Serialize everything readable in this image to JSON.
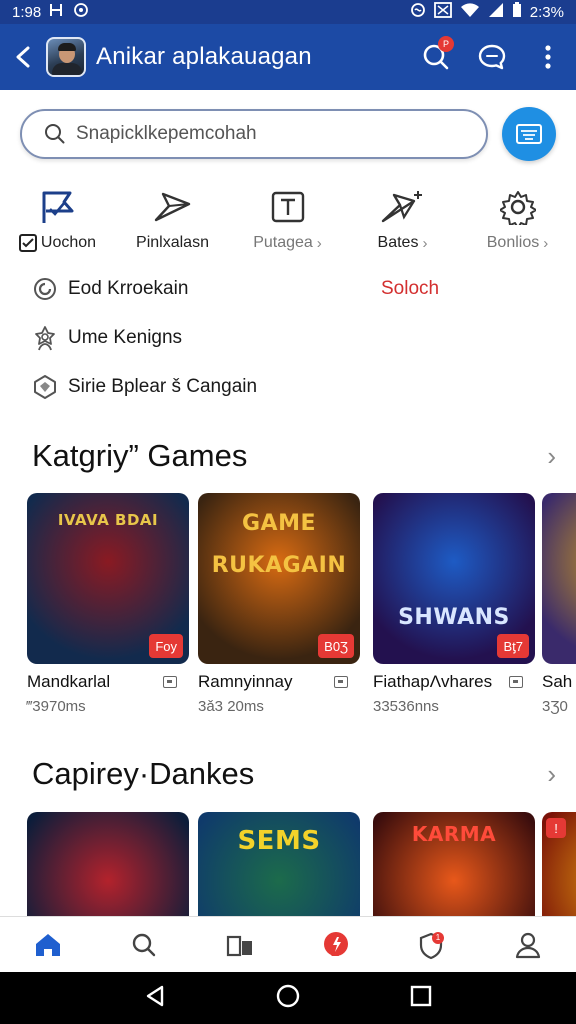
{
  "status_bar": {
    "time": "1:98",
    "left_icons": [
      "sim-icon",
      "sync-icon"
    ],
    "right_icons": [
      "nfc-icon",
      "notification-icon",
      "wifi-icon",
      "signal-icon",
      "battery-icon"
    ],
    "battery": "2:3%"
  },
  "app_bar": {
    "title": "Anikar aplakauagan",
    "notification_badge": "P"
  },
  "search": {
    "placeholder": "Snapicklkepemcohah"
  },
  "quick_actions": [
    {
      "icon": "flag-icon",
      "label": "Uochon",
      "checkbox": true
    },
    {
      "icon": "send-icon",
      "label": "Pinlxalasn"
    },
    {
      "icon": "text-box-icon",
      "label": "Putagea",
      "chevron": true
    },
    {
      "icon": "sparkle-plane-icon",
      "label": "Bates",
      "chevron": true
    },
    {
      "icon": "gear-icon",
      "label": "Bonlios",
      "chevron": true
    }
  ],
  "list_items": [
    {
      "icon": "spinner-icon",
      "label": "Eod Krroekain",
      "side_label": "Soloch"
    },
    {
      "icon": "user-star-icon",
      "label": "Ume Kenigns"
    },
    {
      "icon": "hex-shield-icon",
      "label": "Sirie Bplear š Cangain"
    }
  ],
  "section_1": {
    "title": "Katgriy” Games",
    "cards": [
      {
        "title": "Mandkarlal",
        "meta": "‴3970ms",
        "price": "Foy",
        "art_text": "IVAVA BDAI",
        "colors": [
          "#122a4d",
          "#8a1a22"
        ]
      },
      {
        "title": "Ramnyinnay",
        "meta": "3ǎ3 20ms",
        "price": "B0Ʒ",
        "art_text": "GAME RUKAGAIN",
        "colors": [
          "#3a2411",
          "#d86b12"
        ]
      },
      {
        "title": "FiathapɅvhares",
        "meta": "33536nns",
        "price": "Bƫ7",
        "art_text": "SHWANS",
        "colors": [
          "#23114f",
          "#1e5bc4"
        ]
      },
      {
        "title": "Sah",
        "meta": "3Ʒ0",
        "price": "",
        "art_text": "",
        "colors": [
          "#3a2a6b",
          "#d6a21e"
        ]
      }
    ]
  },
  "section_2": {
    "title": "Capirey·Dankes",
    "cards": [
      {
        "art_text": "",
        "colors": [
          "#0c1d3a",
          "#b3222c"
        ]
      },
      {
        "art_text": "SEMS",
        "colors": [
          "#0f3a6b",
          "#1c6b4b"
        ]
      },
      {
        "art_text": "KARMA",
        "colors": [
          "#3a0d0d",
          "#e8581a"
        ]
      },
      {
        "art_text": "",
        "colors": [
          "#7a1208",
          "#e8a012"
        ],
        "badge": "!"
      }
    ]
  },
  "bottom_nav": [
    {
      "icon": "home-icon",
      "active": true
    },
    {
      "icon": "search-icon"
    },
    {
      "icon": "library-icon"
    },
    {
      "icon": "alert-bubble-icon"
    },
    {
      "icon": "shield-badge-icon",
      "badge": "1"
    },
    {
      "icon": "profile-icon"
    }
  ],
  "colors": {
    "app_bar": "#1c4aa5",
    "status_bar": "#1b3d8f",
    "accent": "#1f8fe3",
    "price_tag": "#e53935",
    "side_label": "#d32f2f"
  }
}
